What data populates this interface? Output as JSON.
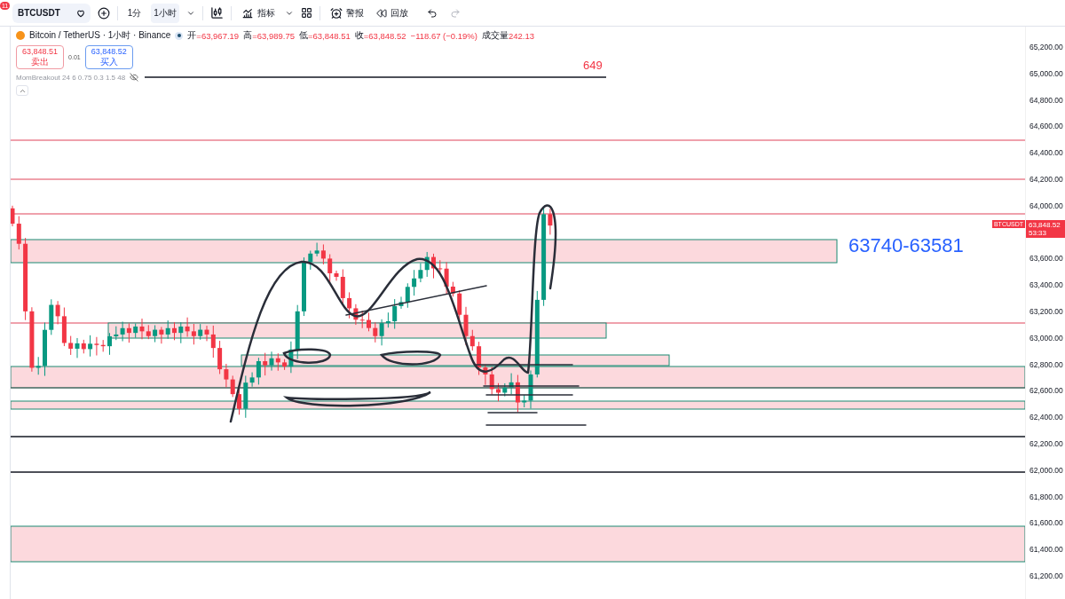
{
  "toolbar": {
    "notification_count": "11",
    "symbol": "BTCUSDT",
    "intervals": [
      {
        "label": "1分",
        "selected": false
      },
      {
        "label": "1小时",
        "selected": true
      }
    ],
    "indicators_label": "指标",
    "alert_label": "警报",
    "replay_label": "回放"
  },
  "legend": {
    "title": "Bitcoin / TetherUS · 1小时 · Binance",
    "ohlc": [
      {
        "label": "开",
        "value": "=63,967.19"
      },
      {
        "label": "高",
        "value": "=63,989.75"
      },
      {
        "label": "低",
        "value": "=63,848.51"
      },
      {
        "label": "收",
        "value": "=63,848.52"
      }
    ],
    "change": "−118.67 (−0.19%)",
    "volume_label": "成交量",
    "volume": "242.13"
  },
  "trade": {
    "sell_price": "63,848.51",
    "sell_label": "卖出",
    "spread": "0.01",
    "buy_price": "63,848.52",
    "buy_label": "买入"
  },
  "indicator": "MomBreakout 24 6 0.75 0.3 1.5 48",
  "annotations": {
    "marker": "649",
    "zone_label": "63740-63581"
  },
  "price_axis": [
    "65,200.00",
    "65,000.00",
    "64,800.00",
    "64,600.00",
    "64,400.00",
    "64,200.00",
    "64,000.00",
    "63,600.00",
    "63,400.00",
    "63,200.00",
    "63,000.00",
    "62,800.00",
    "62,600.00",
    "62,400.00",
    "62,200.00",
    "62,000.00",
    "61,800.00",
    "61,600.00",
    "61,400.00",
    "61,200.00"
  ],
  "price_tag": {
    "symbol": "BTCUSDT",
    "price": "63,848.52",
    "countdown": "53:33"
  }
}
